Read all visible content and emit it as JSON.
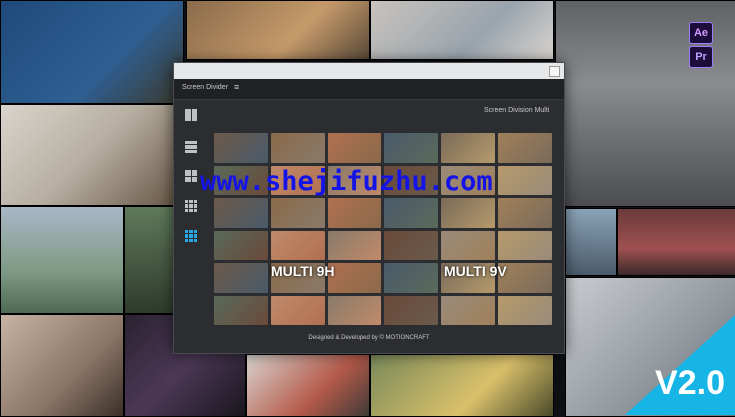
{
  "panel": {
    "name": "Screen Divider",
    "menu": "≡",
    "subtitle": "Screen Division Multi",
    "footer": "Designed & Developed by © MOTIONCRAFT"
  },
  "labels": {
    "multi_h": "MULTI 9H",
    "multi_v": "MULTI 9V"
  },
  "badges": {
    "ae": "Ae",
    "pr": "Pr"
  },
  "version": "V2.0",
  "watermark": "www.shejifuzhu.com",
  "colors": {
    "accent": "#2aa7e6",
    "version_bg": "#17b5e6",
    "watermark": "#1414e6"
  },
  "icons": [
    "layout-2col-icon",
    "layout-3row-icon",
    "layout-4grid-icon",
    "layout-9grid-icon",
    "layout-9grid-active-icon"
  ]
}
